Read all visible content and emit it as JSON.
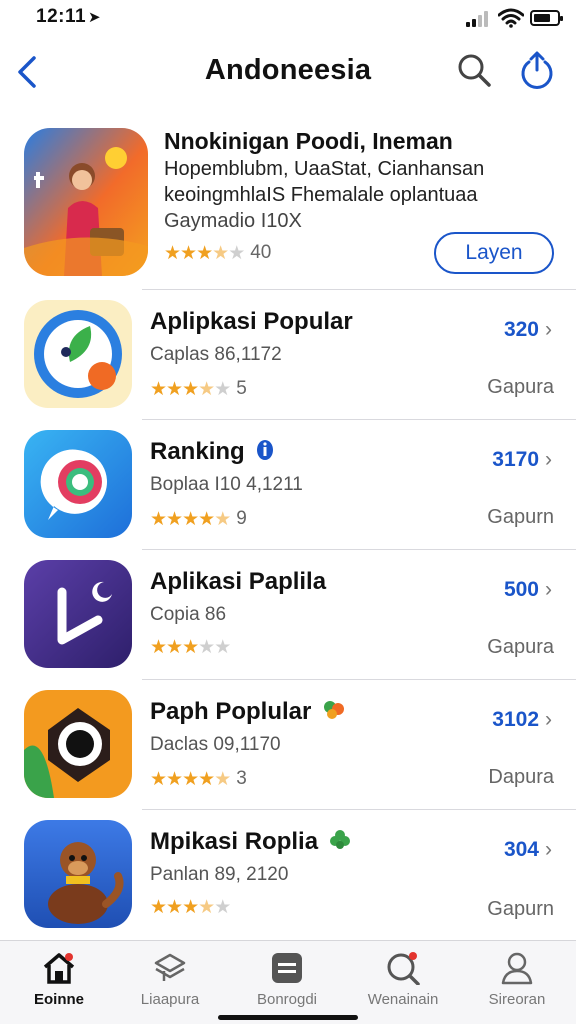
{
  "status_bar": {
    "time": "12:11",
    "location_arrow": "➤"
  },
  "nav": {
    "title": "Andoneesia",
    "back_icon": "chevron-left-icon",
    "search_icon": "search-icon",
    "share_icon": "share-icon"
  },
  "colors": {
    "accent": "#1a55c9",
    "star": "#f0a020"
  },
  "featured": {
    "name": "Nnokinigan Poodi, Ineman",
    "line1": "Hopemblubm, UaaStat, Cianhansan",
    "line2": "keoingmhlaIS Fhemalale oplantuaa",
    "line3": "Gaymadio I10X",
    "stars": 3.5,
    "rating_count": "40",
    "button_label": "Layen"
  },
  "apps": [
    {
      "name": "Aplipkasi Popular",
      "subtitle": "Caplas 86,1172",
      "stars": 3.5,
      "rating_count": "5",
      "price": "320",
      "action": "Gapura",
      "badge": ""
    },
    {
      "name": "Ranking",
      "subtitle": "Boplaa I10 4,1211",
      "stars": 4.5,
      "rating_count": "9",
      "price": "3170",
      "action": "Gapurn",
      "badge": "info"
    },
    {
      "name": "Aplikasi Paplila",
      "subtitle": "Copia 86",
      "stars": 3,
      "rating_count": "",
      "price": "500",
      "action": "Gapura",
      "badge": ""
    },
    {
      "name": "Paph Poplular",
      "subtitle": "Daclas 09,1170",
      "stars": 4.5,
      "rating_count": "3",
      "price": "3102",
      "action": "Dapura",
      "badge": "leaf"
    },
    {
      "name": "Mpikasi Roplia",
      "subtitle": "Panlan 89, 2120",
      "stars": 3.5,
      "rating_count": "",
      "price": "304",
      "action": "Gapurn",
      "badge": "clover"
    }
  ],
  "tabs": [
    {
      "label": "Eoinne",
      "icon": "home-icon",
      "active": true
    },
    {
      "label": "Liaapura",
      "icon": "apps-icon",
      "active": false
    },
    {
      "label": "Bonrogdi",
      "icon": "list-icon",
      "active": false
    },
    {
      "label": "Wenainain",
      "icon": "search-icon",
      "active": false
    },
    {
      "label": "Sireoran",
      "icon": "profile-icon",
      "active": false
    }
  ],
  "chevron": "›"
}
